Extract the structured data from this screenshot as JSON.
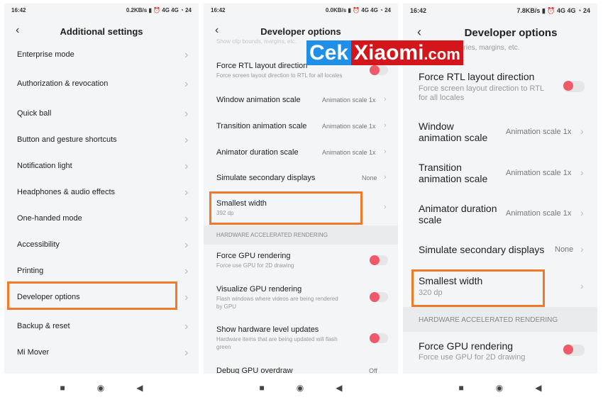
{
  "panels": [
    {
      "status": {
        "time": "16:42",
        "speed": "0.2KB/s",
        "battery": "24"
      },
      "title": "Additional settings",
      "items": [
        "Enterprise mode",
        "Authorization & revocation",
        "Quick ball",
        "Button and gesture shortcuts",
        "Notification light",
        "Headphones & audio effects",
        "One-handed mode",
        "Accessibility",
        "Printing",
        "Developer options",
        "Backup & reset",
        "Mi Mover"
      ],
      "highlighted": "Developer options"
    },
    {
      "status": {
        "time": "16:42",
        "speed": "0.0KB/s",
        "battery": "24"
      },
      "title": "Developer options",
      "partial": "Show clip bounds, margins, etc.",
      "force_rtl": {
        "title": "Force RTL layout direction",
        "sub": "Force screen layout direction to RTL for all locales",
        "on": false
      },
      "window_anim": {
        "title": "Window animation scale",
        "value": "Animation scale 1x"
      },
      "transition_anim": {
        "title": "Transition animation scale",
        "value": "Animation scale 1x"
      },
      "animator_dur": {
        "title": "Animator duration scale",
        "value": "Animation scale 1x"
      },
      "simulate": {
        "title": "Simulate secondary displays",
        "value": "None"
      },
      "smallest": {
        "title": "Smallest width",
        "sub": "392 dp"
      },
      "section": "HARDWARE ACCELERATED RENDERING",
      "force_gpu": {
        "title": "Force GPU rendering",
        "sub": "Force use GPU for 2D drawing",
        "on": false
      },
      "visualize_gpu": {
        "title": "Visualize GPU rendering",
        "sub": "Flash windows where videos are being rendered",
        "sub2": "by GPU",
        "on": false
      },
      "hw_updates": {
        "title": "Show hardware level updates",
        "sub": "Hardware items that are being updated will flash",
        "sub2": "green",
        "on": false
      },
      "debug_gpu": {
        "title": "Debug GPU overdraw",
        "value": "Off"
      }
    },
    {
      "status": {
        "time": "16:42",
        "speed": "7.8KB/s",
        "battery": "24"
      },
      "title": "Developer options",
      "partial": "aries, margins, etc.",
      "force_rtl": {
        "title": "Force RTL layout direction",
        "sub": "Force screen layout direction to RTL",
        "sub2": "for all locales",
        "on": false
      },
      "window_anim": {
        "title": "Window",
        "title2": "animation scale",
        "value": "Animation scale 1x"
      },
      "transition_anim": {
        "title": "Transition",
        "title2": "animation scale",
        "value": "Animation scale 1x"
      },
      "animator_dur": {
        "title": "Animator duration",
        "title2": "scale",
        "value": "Animation scale 1x"
      },
      "simulate": {
        "title": "Simulate secondary displays",
        "value": "None"
      },
      "smallest": {
        "title": "Smallest width",
        "sub": "320 dp"
      },
      "section": "HARDWARE ACCELERATED RENDERING",
      "force_gpu": {
        "title": "Force GPU rendering",
        "sub": "Force use GPU for 2D drawing",
        "on": false
      }
    }
  ],
  "watermark": {
    "part1": "Cek",
    "part2": "Xiaomi",
    "part3": ".com"
  },
  "colors": {
    "highlight": "#ee7a2a",
    "toggle": "#ee5a6a",
    "wm_blue": "#1f8fe8",
    "wm_red": "#d2161c"
  }
}
